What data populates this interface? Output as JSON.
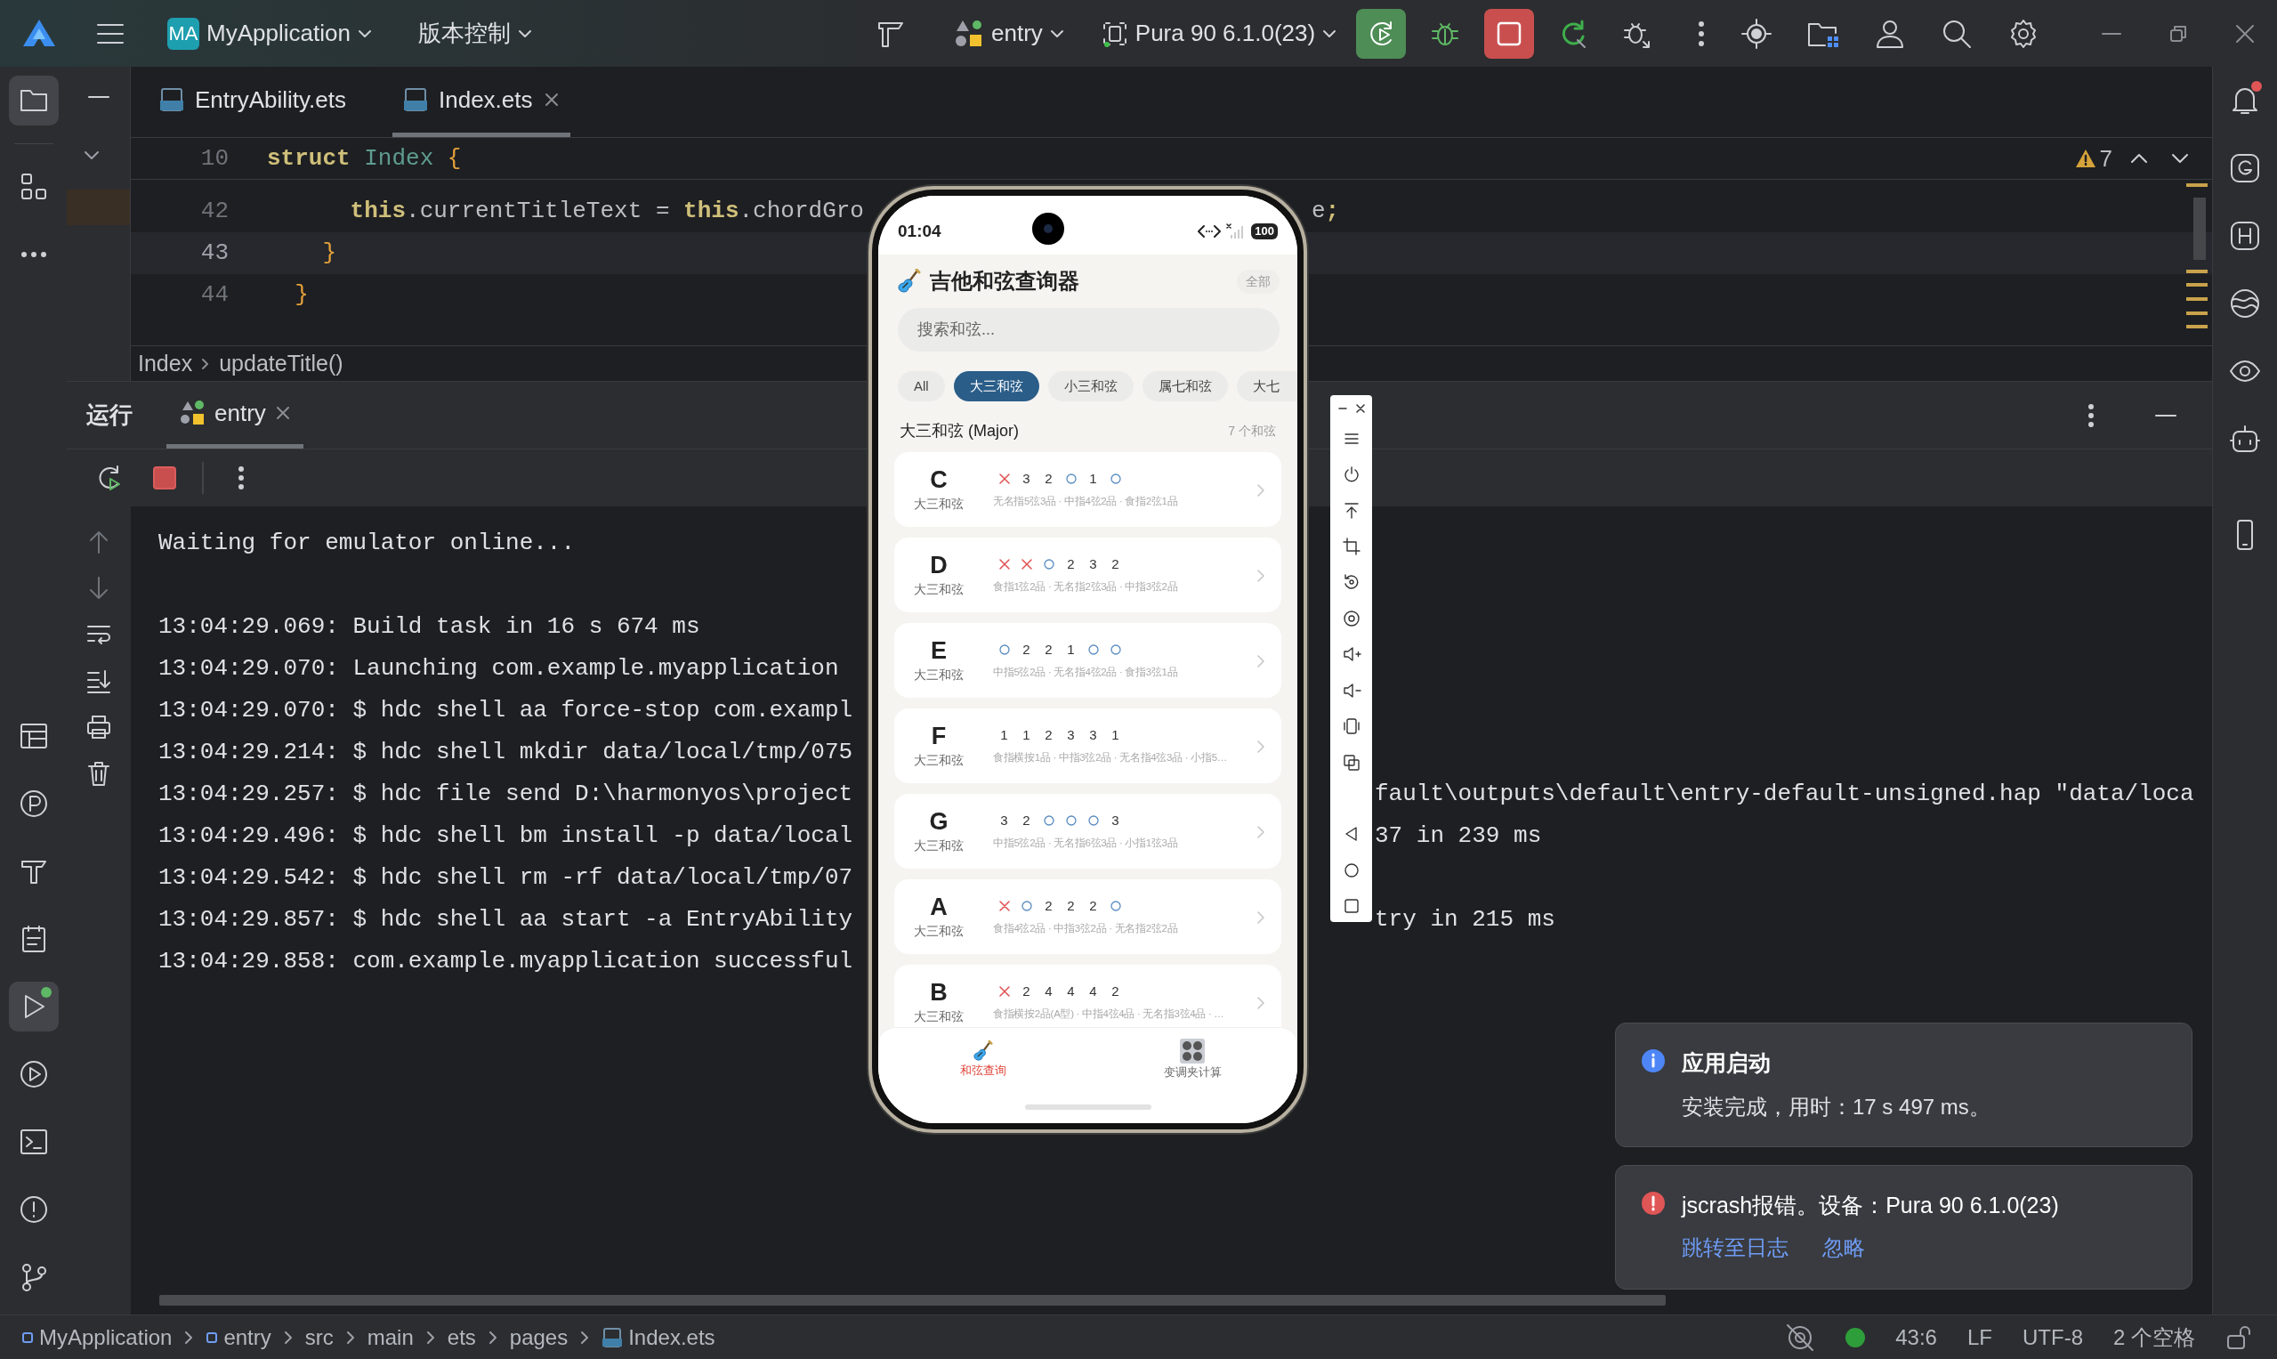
{
  "title_bar": {
    "project_badge": "MA",
    "project": "MyApplication",
    "vcs": "版本控制",
    "run_config": "entry",
    "device": "Pura 90 6.1.0(23)"
  },
  "editor": {
    "tabs": [
      {
        "label": "EntryAbility.ets",
        "selected": false
      },
      {
        "label": "Index.ets",
        "selected": true
      }
    ],
    "warnings": "7",
    "sticky_line": {
      "number": "10",
      "tokens": [
        {
          "text": "struct",
          "kind": "keyword"
        },
        {
          "text": " Index",
          "kind": "type"
        },
        {
          "text": " {",
          "kind": "brace"
        }
      ]
    },
    "lines": [
      {
        "number": "42",
        "current": false,
        "tokens": [
          {
            "text": "      this",
            "kind": "keyword"
          },
          {
            "text": ".currentTitleText = ",
            "kind": "plain"
          },
          {
            "text": "this",
            "kind": "keyword"
          },
          {
            "text": ".chordGro",
            "kind": "plain"
          }
        ],
        "tail": [
          {
            "text": "e",
            "kind": "plain"
          },
          {
            "text": ";",
            "kind": "keyword"
          }
        ]
      },
      {
        "number": "43",
        "current": true,
        "tokens": [
          {
            "text": "    }",
            "kind": "brace"
          }
        ]
      },
      {
        "number": "44",
        "current": false,
        "tokens": [
          {
            "text": "  }",
            "kind": "brace"
          }
        ]
      }
    ],
    "breadcrumb": [
      "Index",
      "updateTitle()"
    ]
  },
  "run_panel": {
    "title": "运行",
    "tabs": [
      {
        "label": "entry",
        "selected": true
      }
    ],
    "console": [
      {
        "text": "Waiting for emulator online..."
      },
      {
        "kind": "blank"
      },
      {
        "text": "13:04:29.069: Build task in 16 s 674 ms"
      },
      {
        "text": "13:04:29.070: Launching com.example.myapplication"
      },
      {
        "text": "13:04:29.070: $ hdc shell aa force-stop com.exampl"
      },
      {
        "text": "13:04:29.214: $ hdc shell mkdir data/local/tmp/075"
      },
      {
        "text": "13:04:29.257: $ hdc file send D:\\harmonyos\\project",
        "tail": "fault\\outputs\\default\\entry-default-unsigned.hap \"data/loca"
      },
      {
        "text": "13:04:29.496: $ hdc shell bm install -p data/local",
        "tail": "37 in 239 ms"
      },
      {
        "text": "13:04:29.542: $ hdc shell rm -rf data/local/tmp/07"
      },
      {
        "text": "13:04:29.857: $ hdc shell aa start -a EntryAbility",
        "tail": "try in 215 ms"
      },
      {
        "text": "13:04:29.858: com.example.myapplication successful"
      }
    ]
  },
  "phone": {
    "time": "01:04",
    "battery": "100",
    "app_title": "吉他和弦查询器",
    "all_button": "全部",
    "search": {
      "placeholder": "搜索和弦..."
    },
    "chips": [
      {
        "label": "All",
        "selected": false
      },
      {
        "label": "大三和弦",
        "selected": true
      },
      {
        "label": "小三和弦",
        "selected": false
      },
      {
        "label": "属七和弦",
        "selected": false
      },
      {
        "label": "大七",
        "selected": false
      }
    ],
    "section": {
      "title": "大三和弦 (Major)",
      "count": "7 个和弦"
    },
    "chords": [
      {
        "name": "C",
        "type": "大三和弦",
        "strings": [
          {
            "kind": "muted"
          },
          {
            "kind": "fret",
            "text": "3"
          },
          {
            "kind": "fret",
            "text": "2"
          },
          {
            "kind": "open"
          },
          {
            "kind": "fret",
            "text": "1"
          },
          {
            "kind": "open"
          }
        ],
        "fingers": "无名指5弦3品 · 中指4弦2品 · 食指2弦1品"
      },
      {
        "name": "D",
        "type": "大三和弦",
        "strings": [
          {
            "kind": "muted"
          },
          {
            "kind": "muted"
          },
          {
            "kind": "open"
          },
          {
            "kind": "fret",
            "text": "2"
          },
          {
            "kind": "fret",
            "text": "3"
          },
          {
            "kind": "fret",
            "text": "2"
          }
        ],
        "fingers": "食指1弦2品 · 无名指2弦3品 · 中指3弦2品"
      },
      {
        "name": "E",
        "type": "大三和弦",
        "strings": [
          {
            "kind": "open"
          },
          {
            "kind": "fret",
            "text": "2"
          },
          {
            "kind": "fret",
            "text": "2"
          },
          {
            "kind": "fret",
            "text": "1"
          },
          {
            "kind": "open"
          },
          {
            "kind": "open"
          }
        ],
        "fingers": "中指5弦2品 · 无名指4弦2品 · 食指3弦1品"
      },
      {
        "name": "F",
        "type": "大三和弦",
        "strings": [
          {
            "kind": "fret",
            "text": "1"
          },
          {
            "kind": "fret",
            "text": "1"
          },
          {
            "kind": "fret",
            "text": "2"
          },
          {
            "kind": "fret",
            "text": "3"
          },
          {
            "kind": "fret",
            "text": "3"
          },
          {
            "kind": "fret",
            "text": "1"
          }
        ],
        "fingers": "食指横按1品 · 中指3弦2品 · 无名指4弦3品 · 小指5…"
      },
      {
        "name": "G",
        "type": "大三和弦",
        "strings": [
          {
            "kind": "fret",
            "text": "3"
          },
          {
            "kind": "fret",
            "text": "2"
          },
          {
            "kind": "open"
          },
          {
            "kind": "open"
          },
          {
            "kind": "open"
          },
          {
            "kind": "fret",
            "text": "3"
          }
        ],
        "fingers": "中指5弦2品 · 无名指6弦3品 · 小指1弦3品"
      },
      {
        "name": "A",
        "type": "大三和弦",
        "strings": [
          {
            "kind": "muted"
          },
          {
            "kind": "open"
          },
          {
            "kind": "fret",
            "text": "2"
          },
          {
            "kind": "fret",
            "text": "2"
          },
          {
            "kind": "fret",
            "text": "2"
          },
          {
            "kind": "open"
          }
        ],
        "fingers": "食指4弦2品 · 中指3弦2品 · 无名指2弦2品"
      },
      {
        "name": "B",
        "type": "大三和弦",
        "strings": [
          {
            "kind": "muted"
          },
          {
            "kind": "fret",
            "text": "2"
          },
          {
            "kind": "fret",
            "text": "4"
          },
          {
            "kind": "fret",
            "text": "4"
          },
          {
            "kind": "fret",
            "text": "4"
          },
          {
            "kind": "fret",
            "text": "2"
          }
        ],
        "fingers": "食指横按2品(A型) · 中指4弦4品 · 无名指3弦4品 · …"
      }
    ],
    "bottom_nav": [
      {
        "label": "和弦查询",
        "selected": true,
        "kind": "guitar"
      },
      {
        "label": "变调夹计算",
        "selected": false,
        "kind": "amp"
      }
    ]
  },
  "notifications": [
    {
      "kind": "info",
      "title": "应用启动",
      "body": "安装完成，用时：17 s 497 ms。"
    },
    {
      "kind": "error",
      "title": "jscrash报错。设备：Pura 90 6.1.0(23)",
      "actions": [
        "跳转至日志",
        "忽略"
      ]
    }
  ],
  "status_bar": {
    "path": [
      "MyApplication",
      "entry",
      "src",
      "main",
      "ets",
      "pages",
      "Index.ets"
    ],
    "position": "43:6",
    "line_ending": "LF",
    "encoding": "UTF-8",
    "indent": "2 个空格"
  }
}
